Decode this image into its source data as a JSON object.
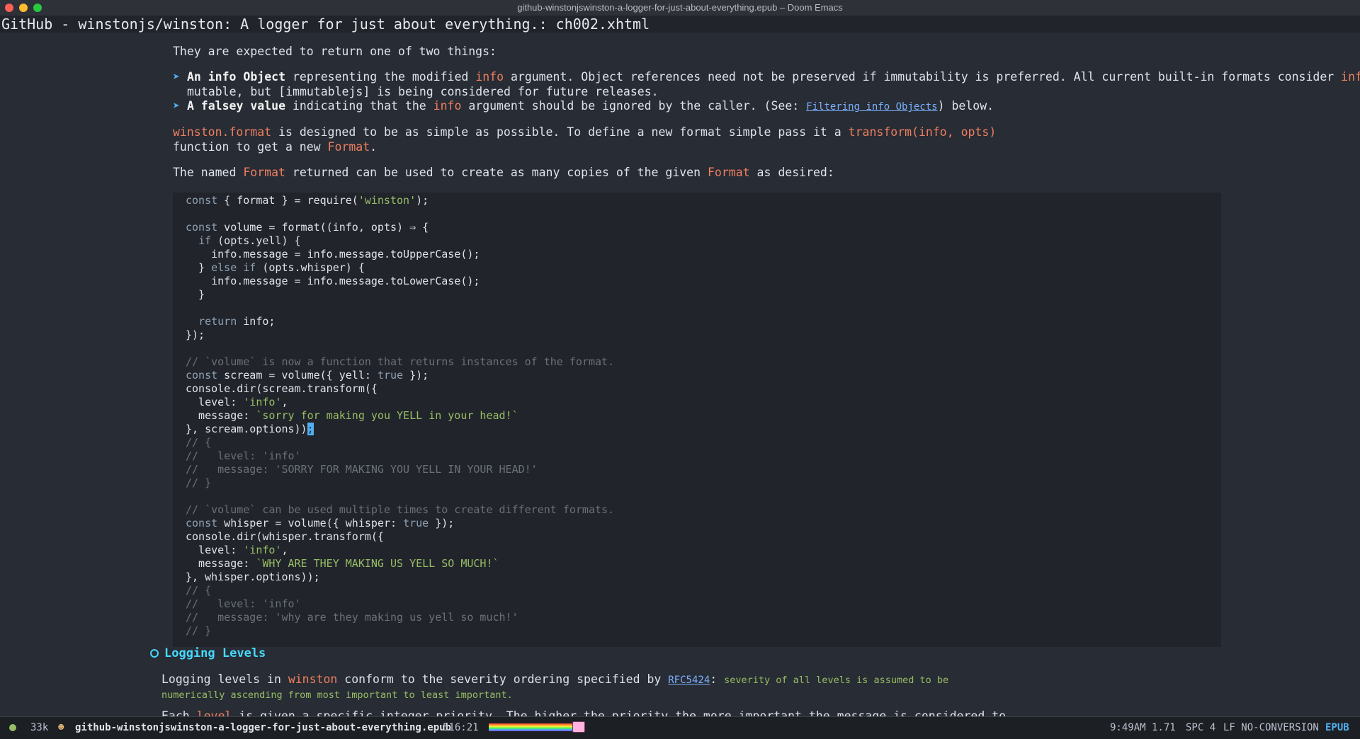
{
  "window": {
    "title": "github-winstonjswinston-a-logger-for-just-about-everything.epub – Doom Emacs"
  },
  "header": {
    "title": "GitHub - winstonjs/winston: A logger for just about everything.: ch002.xhtml"
  },
  "doc": {
    "p1": "They are expected to return one of two things:",
    "bullet1": {
      "b1": "An ",
      "b2": "info",
      "b3": " Object",
      "t1": " representing the modified ",
      "t2": "info",
      "t3": " argument. Object references need not be preserved if immutability is preferred. All current built-in formats consider ",
      "t4": "info",
      "t5": "mutable, but [immutablejs] is being considered for future releases."
    },
    "bullet2": {
      "b1": "A falsey value",
      "t1": " indicating that the ",
      "t2": "info",
      "t3": " argument should be ignored by the caller. (See: ",
      "link": "Filtering info Objects",
      "t4": ") below."
    },
    "p2": {
      "a": "winston.format",
      "b": " is designed to be as simple as possible. To define a new format simple pass it a ",
      "c": "transform(info, opts)",
      "d": "function to get a new ",
      "e": "Format",
      "f": "."
    },
    "p3": {
      "a": "The named ",
      "b": "Format",
      "c": " returned can be used to create as many copies of the given ",
      "d": "Format",
      "e": " as desired:"
    },
    "heading": "Logging Levels",
    "p4": {
      "a": "Logging levels in ",
      "b": "winston",
      "c": " conform to the severity ordering specified by ",
      "link": "RFC5424",
      "d": ": ",
      "e": "severity of all levels is assumed to be",
      "f": "numerically ascending from most important to least important."
    },
    "p5": {
      "a": "Each ",
      "b": "level",
      "c": " is given a specific integer priority. The higher the priority the more important the message is considered to"
    }
  },
  "modeline": {
    "size": "33k",
    "filename": "github-winstonjswinston-a-logger-for-just-about-everything.epub",
    "position": "516:21",
    "time": "9:49AM 1.71",
    "indent": "SPC 4",
    "encoding": "LF NO-CONVERSION",
    "mode": "EPUB"
  }
}
